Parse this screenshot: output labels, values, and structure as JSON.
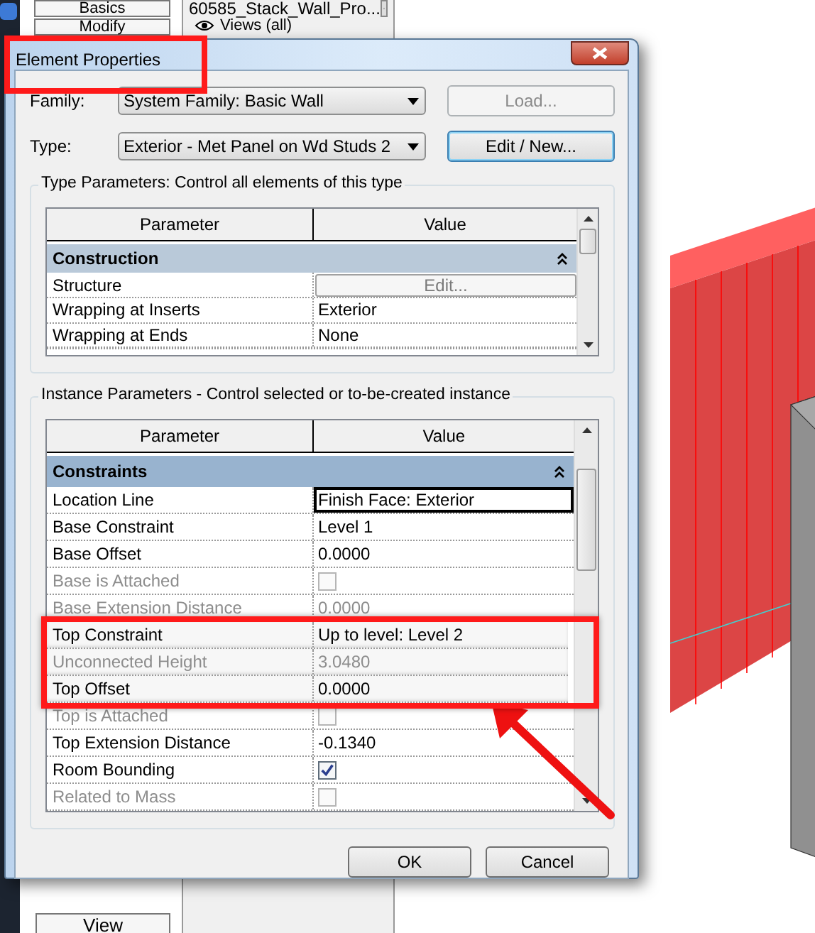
{
  "app": {
    "ribbon_tabs": [
      "Basics",
      "Modify"
    ],
    "bottom_tab": "View",
    "project_browser": {
      "title": "60585_Stack_Wall_Pro...",
      "tree_item": "Views (all)"
    }
  },
  "dialog": {
    "title": "Element Properties",
    "title_highlighted": true,
    "family": {
      "label": "Family:",
      "value": "System Family: Basic Wall"
    },
    "type": {
      "label": "Type:",
      "value": "Exterior - Met Panel on Wd Studs 2"
    },
    "buttons": [
      {
        "label": "Load...",
        "disabled": true
      },
      {
        "label": "Edit / New...",
        "disabled": false
      }
    ],
    "type_parameters": {
      "legend": "Type Parameters: Control all elements of this type",
      "columns": [
        "Parameter",
        "Value"
      ],
      "rows": [
        {
          "kind": "group",
          "name": "Construction",
          "expanded": true
        },
        {
          "kind": "button",
          "name": "Structure",
          "value": "Edit...",
          "disabled": false
        },
        {
          "kind": "text",
          "name": "Wrapping at Inserts",
          "value": "Exterior",
          "disabled": false
        },
        {
          "kind": "text",
          "name": "Wrapping at Ends",
          "value": "None",
          "disabled": false
        }
      ]
    },
    "instance_parameters": {
      "legend": "Instance Parameters - Control selected or to-be-created instance",
      "columns": [
        "Parameter",
        "Value"
      ],
      "rows": [
        {
          "kind": "group",
          "name": "Constraints",
          "expanded": true,
          "highlighted": false
        },
        {
          "kind": "text",
          "name": "Location Line",
          "value": "Finish Face: Exterior",
          "disabled": false,
          "selected": true,
          "highlighted": false
        },
        {
          "kind": "text",
          "name": "Base Constraint",
          "value": "Level 1",
          "disabled": false,
          "selected": false,
          "highlighted": false
        },
        {
          "kind": "text",
          "name": "Base Offset",
          "value": "0.0000",
          "disabled": false,
          "selected": false,
          "highlighted": false
        },
        {
          "kind": "checkbox",
          "name": "Base is Attached",
          "checked": false,
          "disabled": true,
          "selected": false,
          "highlighted": false
        },
        {
          "kind": "text",
          "name": "Base Extension Distance",
          "value": "0.0000",
          "disabled": true,
          "selected": false,
          "highlighted": false
        },
        {
          "kind": "text",
          "name": "Top Constraint",
          "value": "Up to level: Level 2",
          "disabled": false,
          "selected": false,
          "highlighted": true
        },
        {
          "kind": "text",
          "name": "Unconnected Height",
          "value": "3.0480",
          "disabled": true,
          "selected": false,
          "highlighted": true
        },
        {
          "kind": "text",
          "name": "Top Offset",
          "value": "0.0000",
          "disabled": false,
          "selected": false,
          "highlighted": true
        },
        {
          "kind": "checkbox",
          "name": "Top is Attached",
          "checked": false,
          "disabled": true,
          "selected": false,
          "highlighted": false
        },
        {
          "kind": "text",
          "name": "Top Extension Distance",
          "value": "-0.1340",
          "disabled": false,
          "selected": false,
          "highlighted": false
        },
        {
          "kind": "checkbox",
          "name": "Room Bounding",
          "checked": true,
          "disabled": false,
          "selected": false,
          "highlighted": false
        },
        {
          "kind": "checkbox",
          "name": "Related to Mass",
          "checked": false,
          "disabled": true,
          "selected": false,
          "highlighted": false
        }
      ]
    },
    "footer_buttons": [
      "OK",
      "Cancel"
    ]
  }
}
